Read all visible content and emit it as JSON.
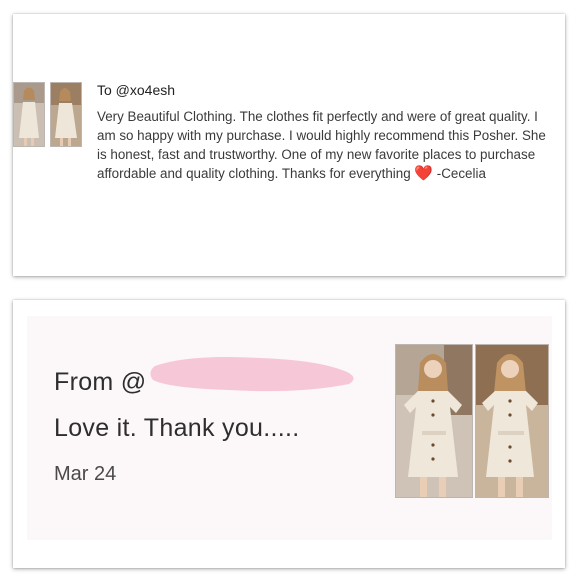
{
  "review": {
    "to": "To @xo4esh",
    "body_before_heart": "Very Beautiful Clothing. The clothes fit perfectly and were of great quality. I am so happy with my purchase. I would highly recommend this Posher. She is honest, fast and trustworthy. One of my new favorite places to purchase affordable and quality clothing. Thanks for everything",
    "heart": "❤️",
    "signature": " -Cecelia",
    "thumbnails": [
      "product-photo-front",
      "product-photo-side"
    ]
  },
  "comment": {
    "from_prefix": "From @",
    "message": "Love it. Thank you.....",
    "date": "Mar 24",
    "redaction_color": "#f6c7d6",
    "thumbnails": [
      "product-photo-front",
      "product-photo-side"
    ]
  },
  "colors": {
    "dress": "#e9e1d3",
    "background_photo": "#c9bdb2",
    "heart": "#e0261f"
  }
}
